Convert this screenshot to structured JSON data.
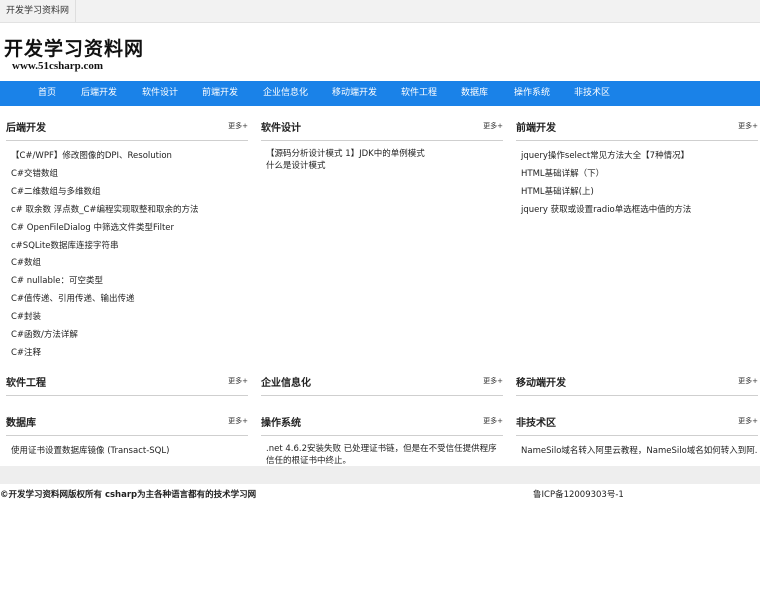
{
  "topbar": {
    "site_link": "开发学习资料网"
  },
  "logo": {
    "name_cn": "开发学习资料网",
    "url": "www.51csharp.com"
  },
  "nav": {
    "items": [
      "首页",
      "后端开发",
      "软件设计",
      "前端开发",
      "企业信息化",
      "移动端开发",
      "软件工程",
      "数据库",
      "操作系统",
      "非技术区"
    ]
  },
  "sections": {
    "backend": {
      "title": "后端开发",
      "more": "更多+",
      "items": [
        "【C#/WPF】修改图像的DPI、Resolution",
        "C#交错数组",
        "C#二维数组与多维数组",
        "c# 取余数 浮点数_C#编程实现取整和取余的方法",
        "C# OpenFileDialog 中筛选文件类型Filter",
        "c#SQLite数据库连接字符串",
        "C#数组",
        "C# nullable：可空类型",
        "C#值传递、引用传递、输出传递",
        "C#封装",
        "C#函数/方法详解",
        "C#注释"
      ]
    },
    "design": {
      "title": "软件设计",
      "more": "更多+",
      "items": [
        "【源码分析设计模式 1】JDK中的单例模式",
        "什么是设计模式"
      ]
    },
    "frontend": {
      "title": "前端开发",
      "more": "更多+",
      "items": [
        "jquery操作select常见方法大全【7种情况】",
        "HTML基础详解（下）",
        "HTML基础详解(上)",
        "jquery 获取或设置radio单选框选中值的方法"
      ]
    },
    "swe": {
      "title": "软件工程",
      "more": "更多+"
    },
    "enterprise": {
      "title": "企业信息化",
      "more": "更多+"
    },
    "mobile": {
      "title": "移动端开发",
      "more": "更多+"
    },
    "database": {
      "title": "数据库",
      "more": "更多+",
      "items": [
        "使用证书设置数据库镜像 (Transact-SQL)"
      ]
    },
    "os": {
      "title": "操作系统",
      "more": "更多+",
      "items": [
        ".net 4.6.2安装失败 已处理证书链，但是在不受信任提供程序信任的根证书中终止。"
      ]
    },
    "nontech": {
      "title": "非技术区",
      "more": "更多+",
      "items": [
        "NameSilo域名转入阿里云教程，NameSilo域名如何转入到阿..."
      ]
    }
  },
  "footer": {
    "copyright": "©开发学习资料网版权所有 csharp为主各种语言都有的技术学习网",
    "icp": "鲁ICP备12009303号-1"
  }
}
